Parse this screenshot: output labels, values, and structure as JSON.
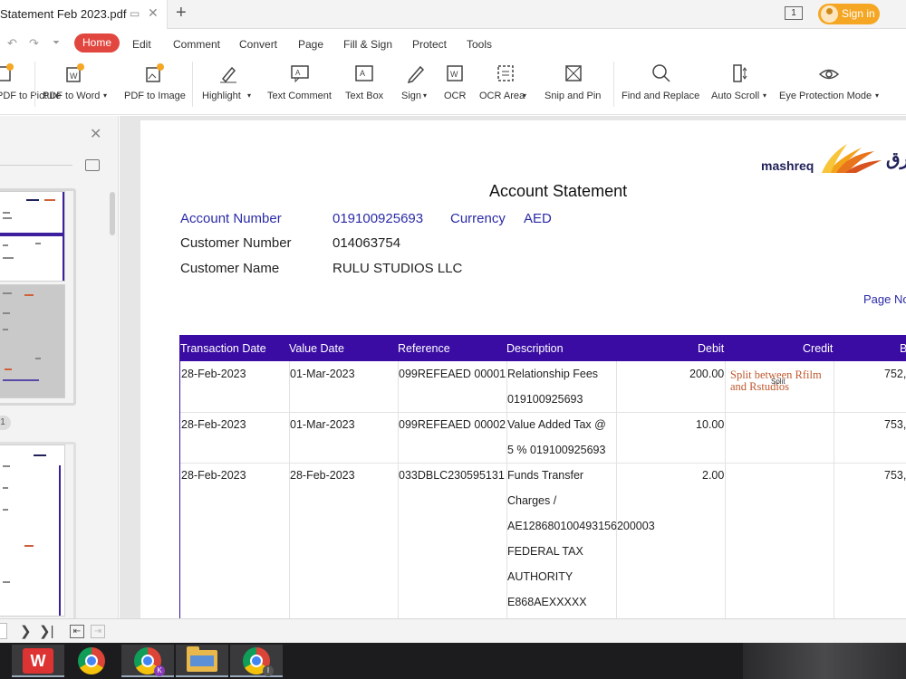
{
  "window": {
    "tab_title": "Statement Feb 2023.pdf",
    "page_indicator": "1",
    "sign_in": "Sign in"
  },
  "menu": {
    "home": "Home",
    "items": [
      "Edit",
      "Comment",
      "Convert",
      "Page",
      "Fill & Sign",
      "Protect",
      "Tools"
    ]
  },
  "toolbar": {
    "items": [
      "PDF to Picture",
      "PDF to Word",
      "PDF to Image",
      "Highlight",
      "Text Comment",
      "Text Box",
      "Sign",
      "OCR",
      "OCR Area",
      "Snip and Pin",
      "Find and Replace",
      "Auto Scroll",
      "Eye Protection Mode"
    ],
    "icons": [
      "picture-icon",
      "pdf-to-word-icon",
      "pdf-to-image-icon",
      "highlight-icon",
      "text-comment-icon",
      "text-box-icon",
      "sign-icon",
      "ocr-icon",
      "ocr-area-icon",
      "snip-pin-icon",
      "find-replace-icon",
      "auto-scroll-icon",
      "eye-protection-icon"
    ]
  },
  "sidebar": {
    "badge": "1"
  },
  "statement": {
    "bank_name": "mashreq",
    "bank_arabic": "رق",
    "title": "Account Statement",
    "account_number_label": "Account Number",
    "account_number": "019100925693",
    "currency_label": "Currency",
    "currency": "AED",
    "customer_number_label": "Customer Number",
    "customer_number": "014063754",
    "customer_name_label": "Customer Name",
    "customer_name": "RULU STUDIOS LLC",
    "page_no_label": "Page No",
    "columns": [
      "Transaction Date",
      "Value Date",
      "Reference",
      "Description",
      "Debit",
      "Credit",
      "B"
    ],
    "rows": [
      {
        "transaction_date": "28-Feb-2023",
        "value_date": "01-Mar-2023",
        "reference": "099REFEAED 00001",
        "description": [
          "Relationship Fees",
          "019100925693"
        ],
        "debit": "200.00",
        "credit": "",
        "balance": "752,",
        "note": "Split between Rfilm and Rstudios",
        "note_tag": "Split"
      },
      {
        "transaction_date": "28-Feb-2023",
        "value_date": "01-Mar-2023",
        "reference": "099REFEAED 00002",
        "description": [
          "Value Added Tax @",
          "5 % 019100925693"
        ],
        "debit": "10.00",
        "credit": "",
        "balance": "753,"
      },
      {
        "transaction_date": "28-Feb-2023",
        "value_date": "28-Feb-2023",
        "reference": "033DBLC230595131",
        "description": [
          "Funds Transfer",
          "Charges /",
          "AE128680100493156200003",
          "FEDERAL TAX",
          "AUTHORITY",
          "E868AEXXXXX"
        ],
        "debit": "2.00",
        "credit": "",
        "balance": "753,"
      }
    ]
  },
  "colors": {
    "header_band": "#3a0ca3",
    "home_tab": "#e2473f",
    "sign_in": "#f5a623",
    "label_blue": "#2a2aa8",
    "note_orange": "#c0582e"
  }
}
